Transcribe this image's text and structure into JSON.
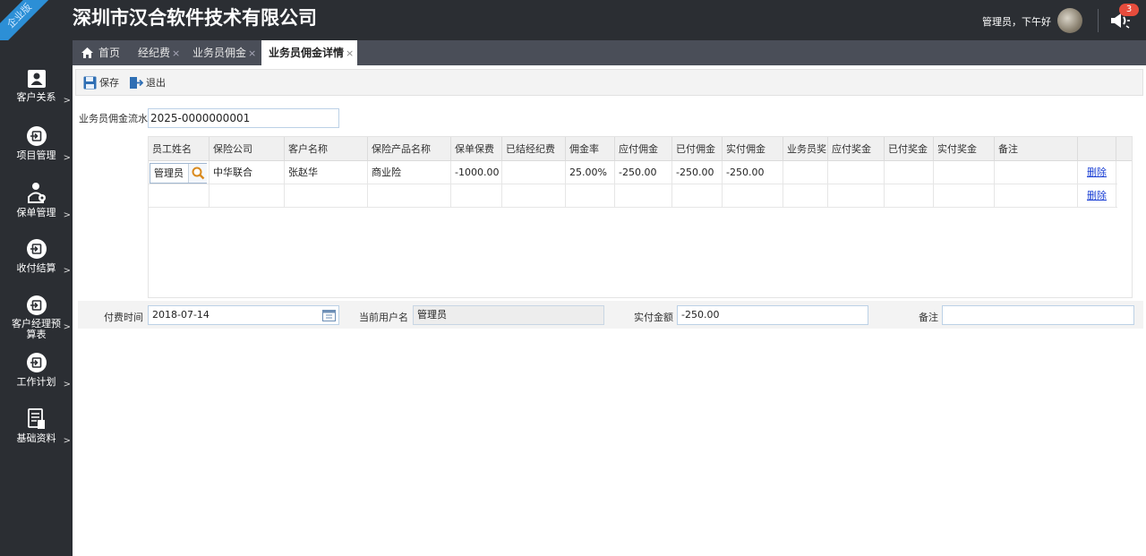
{
  "header": {
    "ribbon": "企业版",
    "company": "深圳市汉合软件技术有限公司",
    "greeting": "管理员，下午好",
    "notification_count": "3"
  },
  "tabs": [
    {
      "label": "首页",
      "closable": false
    },
    {
      "label": "经纪费",
      "closable": true
    },
    {
      "label": "业务员佣金",
      "closable": true
    },
    {
      "label": "业务员佣金详情",
      "closable": true,
      "active": true
    }
  ],
  "tab_close": "×",
  "sidebar": {
    "arrow": ">",
    "items": [
      {
        "label": "客户关系",
        "icon": "user-card-icon"
      },
      {
        "label": "项目管理",
        "icon": "login-icon"
      },
      {
        "label": "保单管理",
        "icon": "user-gear-icon"
      },
      {
        "label": "收付结算",
        "icon": "login-icon"
      },
      {
        "label": "客户经理预算表",
        "icon": "login-icon"
      },
      {
        "label": "工作计划",
        "icon": "login-icon"
      },
      {
        "label": "基础资料",
        "icon": "document-list-icon"
      }
    ]
  },
  "toolbar": {
    "save_label": "保存",
    "exit_label": "退出"
  },
  "form": {
    "serial_label": "业务员佣金流水:",
    "serial_value": "2025-0000000001",
    "pay_time_label": "付费时间",
    "pay_time_value": "2018-07-14",
    "current_user_label": "当前用户名",
    "current_user_value": "管理员",
    "actual_amount_label": "实付金额",
    "actual_amount_value": "-250.00",
    "remark_label": "备注",
    "remark_value": ""
  },
  "grid": {
    "columns": [
      "员工姓名",
      "保险公司",
      "客户名称",
      "保险产品名称",
      "保单保费",
      "已结经纪费",
      "佣金率",
      "应付佣金",
      "已付佣金",
      "实付佣金",
      "业务员奖",
      "应付奖金",
      "已付奖金",
      "实付奖金",
      "备注"
    ],
    "rows": [
      {
        "employee": "管理员",
        "insurer": "中华联合",
        "customer": "张赵华",
        "product": "商业险",
        "premium": "-1000.00",
        "settled_fee": "",
        "rate": "25.00%",
        "payable_comm": "-250.00",
        "paid_comm": "-250.00",
        "actual_comm": "-250.00",
        "bonus": "",
        "payable_bonus": "",
        "paid_bonus": "",
        "actual_bonus": "",
        "remark": "",
        "action": "删除"
      },
      {
        "employee": "",
        "insurer": "",
        "customer": "",
        "product": "",
        "premium": "",
        "settled_fee": "",
        "rate": "",
        "payable_comm": "",
        "paid_comm": "",
        "actual_comm": "",
        "bonus": "",
        "payable_bonus": "",
        "paid_bonus": "",
        "actual_bonus": "",
        "remark": "",
        "action": "删除"
      }
    ]
  },
  "colors": {
    "dark": "#2b2e33",
    "tabbar": "#4a4e58",
    "ribbon": "#2c8fd6",
    "badge": "#e74c3c",
    "link": "#1a3fd4"
  }
}
